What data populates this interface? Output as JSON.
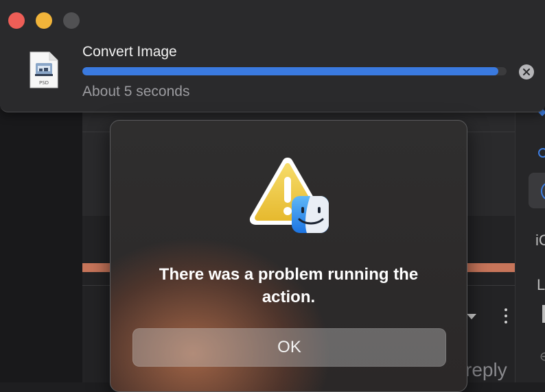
{
  "notification": {
    "title": "Convert Image",
    "status": "About 5 seconds",
    "progress_fraction": 0.98,
    "file_type_label": "PSD",
    "accent_color": "#3a7ae0"
  },
  "alert": {
    "message": "There was a problem running the action.",
    "ok_label": "OK",
    "icon": "warning-with-finder-badge-icon"
  },
  "background": {
    "partial_text": "reply",
    "right_panel_letters": [
      "iC",
      "L"
    ]
  }
}
